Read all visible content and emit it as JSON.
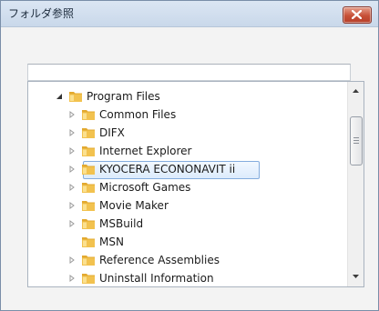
{
  "window": {
    "title": "フォルダ参照"
  },
  "path_input": {
    "value": ""
  },
  "tree": {
    "items": [
      {
        "label": "Program Files",
        "level": 0,
        "expanded": true,
        "has_children": true,
        "selected": false
      },
      {
        "label": "Common Files",
        "level": 1,
        "expanded": false,
        "has_children": true,
        "selected": false
      },
      {
        "label": "DIFX",
        "level": 1,
        "expanded": false,
        "has_children": true,
        "selected": false
      },
      {
        "label": "Internet Explorer",
        "level": 1,
        "expanded": false,
        "has_children": true,
        "selected": false
      },
      {
        "label": "KYOCERA ECONONAVIT ii",
        "level": 1,
        "expanded": false,
        "has_children": true,
        "selected": true
      },
      {
        "label": "Microsoft Games",
        "level": 1,
        "expanded": false,
        "has_children": true,
        "selected": false
      },
      {
        "label": "Movie Maker",
        "level": 1,
        "expanded": false,
        "has_children": true,
        "selected": false
      },
      {
        "label": "MSBuild",
        "level": 1,
        "expanded": false,
        "has_children": true,
        "selected": false
      },
      {
        "label": "MSN",
        "level": 1,
        "expanded": false,
        "has_children": false,
        "selected": false
      },
      {
        "label": "Reference Assemblies",
        "level": 1,
        "expanded": false,
        "has_children": true,
        "selected": false
      },
      {
        "label": "Uninstall Information",
        "level": 1,
        "expanded": false,
        "has_children": true,
        "selected": false
      }
    ]
  },
  "colors": {
    "folder": "#f2c24f",
    "selection_border": "#84acdd",
    "close_button": "#c75037"
  }
}
